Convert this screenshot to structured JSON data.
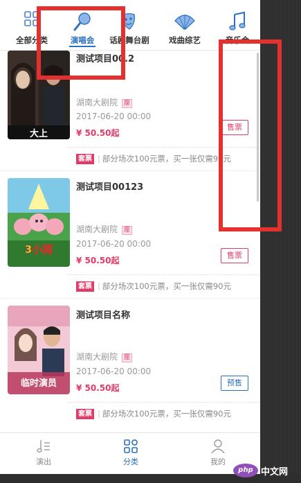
{
  "categories": [
    {
      "label": "全部分类",
      "icon": "grid-icon",
      "active": false
    },
    {
      "label": "演唱会",
      "icon": "microphone-icon",
      "active": true
    },
    {
      "label": "话剧舞台剧",
      "icon": "theater-mask-icon",
      "active": false
    },
    {
      "label": "戏曲综艺",
      "icon": "fan-icon",
      "active": false
    },
    {
      "label": "音乐会",
      "icon": "music-note-icon",
      "active": false
    }
  ],
  "items": [
    {
      "title": "测试项目00.2",
      "venue": "湖南大剧院",
      "seat_tag": "座",
      "date": "2017-06-20 00:00",
      "price": "¥ 50.50起",
      "button": "售票",
      "promo_tag": "套票",
      "promo_text": "部分场次100元票，买一张仅需90元",
      "poster_caption": "大上"
    },
    {
      "title": "测试项目00123",
      "venue": "湖南大剧院",
      "seat_tag": "座",
      "date": "2017-06-20 00:00",
      "price": "¥ 50.50起",
      "button": "售票",
      "promo_tag": "套票",
      "promo_text": "部分场次100元票，买一张仅需90元",
      "poster_caption": "3小猪"
    },
    {
      "title": "测试项目名称",
      "venue": "湖南大剧院",
      "seat_tag": "座",
      "date": "2017-06-20 00:00",
      "price": "¥ 50.50起",
      "button": "预售",
      "promo_tag": "套票",
      "promo_text": "部分场次100元票，买一张仅需90元",
      "poster_caption": "临时演员"
    }
  ],
  "bottom_nav": [
    {
      "label": "演出",
      "icon": "music-sheet-icon",
      "active": false
    },
    {
      "label": "分类",
      "icon": "category-grid-icon",
      "active": true
    },
    {
      "label": "我的",
      "icon": "user-icon",
      "active": false
    }
  ],
  "watermark": {
    "logo": "php",
    "text": "中文网"
  },
  "colors": {
    "accent": "#2b6fc0",
    "price": "#e23a68",
    "annotation": "#e53030"
  }
}
